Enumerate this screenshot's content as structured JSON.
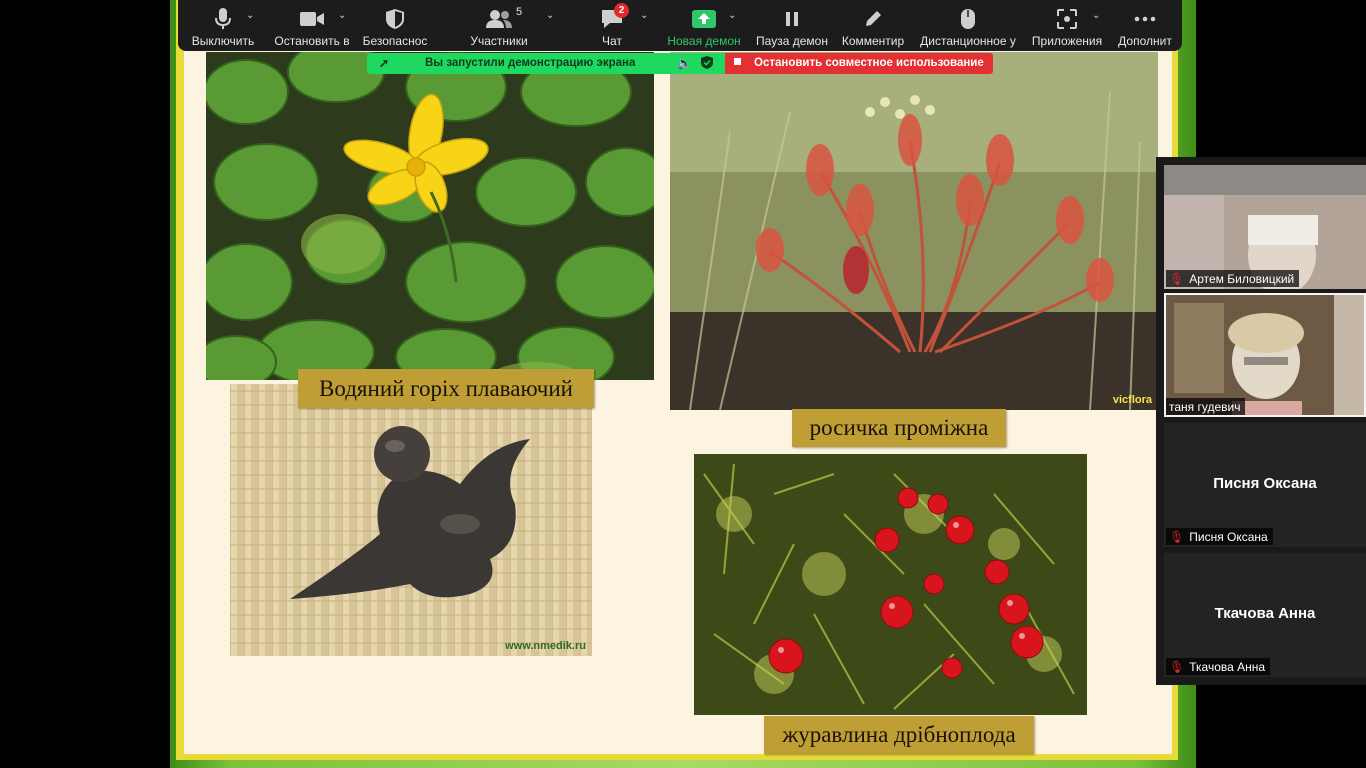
{
  "toolbar": {
    "buttons": [
      {
        "label": "Выключить",
        "icon": "microphone-icon"
      },
      {
        "label": "Остановить в",
        "icon": "video-camera-icon"
      },
      {
        "label": "Безопаснос",
        "icon": "shield-icon"
      },
      {
        "label": "Участники",
        "icon": "participants-icon",
        "count": "5"
      },
      {
        "label": "Чат",
        "icon": "chat-icon",
        "badge": "2"
      },
      {
        "label": "Новая демон",
        "icon": "share-screen-icon"
      },
      {
        "label": "Пауза демон",
        "icon": "pause-icon"
      },
      {
        "label": "Комментир",
        "icon": "annotate-pencil-icon"
      },
      {
        "label": "Дистанционное у",
        "icon": "remote-control-mouse-icon"
      },
      {
        "label": "Приложения",
        "icon": "apps-icon"
      },
      {
        "label": "Дополнит",
        "icon": "more-icon"
      }
    ]
  },
  "share_bar": {
    "status": "Вы запустили демонстрацию экрана",
    "stop_label": "Остановить совместное использование",
    "accent": "#1fd85f",
    "stop_color": "#e33032"
  },
  "slide": {
    "captions": {
      "water_chestnut": "Водяний горіх плаваючий",
      "sundew": "росичка проміжна",
      "cranberry": "журавлина дрібноплода"
    },
    "watermark": "www.nmedik.ru"
  },
  "participants": [
    {
      "name": "Артем Биловицкий",
      "muted": true,
      "video": true
    },
    {
      "name": "таня гудевич",
      "muted": false,
      "video": true,
      "active": true
    },
    {
      "name": "Писня Оксана",
      "muted": true,
      "video": false
    },
    {
      "name": "Ткачова Анна",
      "muted": true,
      "video": false
    }
  ]
}
